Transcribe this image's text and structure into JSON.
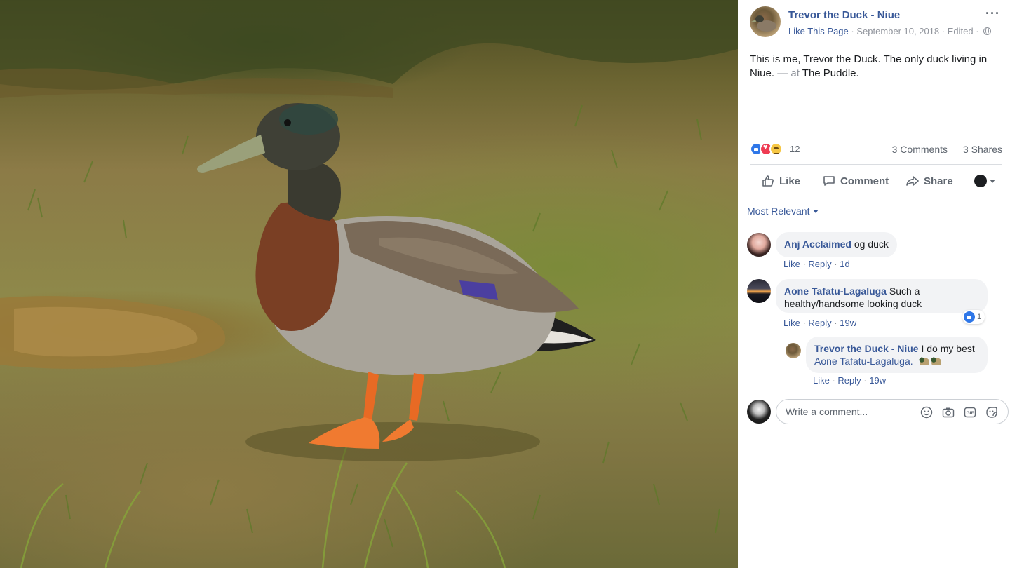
{
  "post": {
    "page_name": "Trevor the Duck - Niue",
    "like_page": "Like This Page",
    "date": "September 10, 2018",
    "edited": "Edited",
    "text_main": "This is me, Trevor the Duck. The only duck living in Niue.",
    "text_at": " — at ",
    "place": "The Puddle",
    "text_end": "."
  },
  "reactions": {
    "icons": [
      "like-icon",
      "love-icon",
      "sad-icon"
    ],
    "count": "12",
    "comments": "3 Comments",
    "shares": "3 Shares"
  },
  "actions": {
    "like": "Like",
    "comment": "Comment",
    "share": "Share"
  },
  "filter": "Most Relevant",
  "comments": [
    {
      "author": "Anj Acclaimed",
      "text": "og duck",
      "like": "Like",
      "reply": "Reply",
      "time": "1d"
    },
    {
      "author": "Aone Tafatu-Lagaluga",
      "text": "Such a healthy/handsome looking duck",
      "like": "Like",
      "reply": "Reply",
      "time": "19w",
      "likes": "1"
    },
    {
      "author": "Trevor the Duck - Niue",
      "text": "I do my best",
      "mention": "Aone Tafatu-Lagaluga.",
      "like": "Like",
      "reply": "Reply",
      "time": "19w"
    }
  ],
  "composer": {
    "placeholder": "Write a comment...",
    "icons": [
      "emoji-icon",
      "camera-icon",
      "gif-icon",
      "sticker-icon"
    ]
  },
  "colors": {
    "link": "#385898",
    "muted": "#90949c",
    "bubble": "#f2f3f5",
    "like_blue": "#2f77e8"
  }
}
